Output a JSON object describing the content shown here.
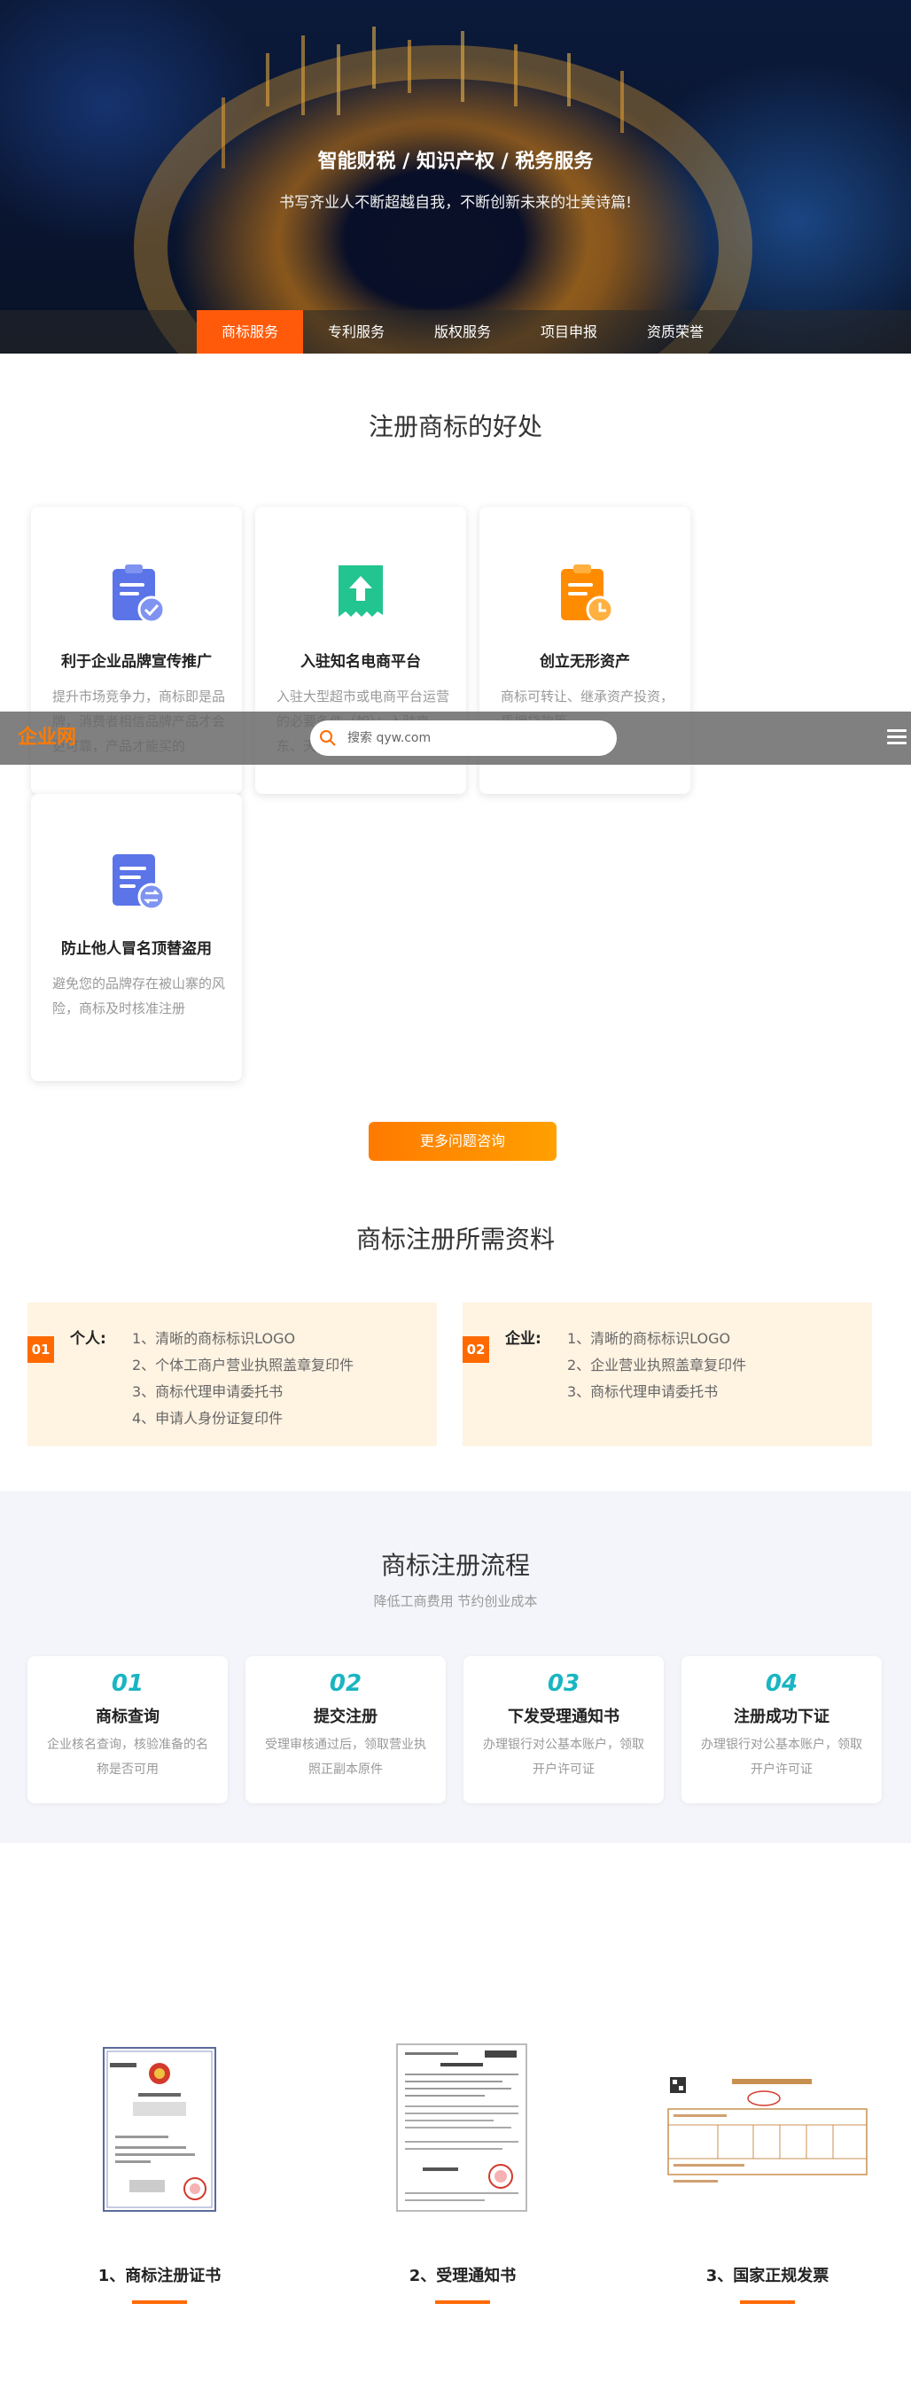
{
  "hero": {
    "title": "智能财税 / 知识产权 / 税务服务",
    "subtitle": "书写齐业人不断超越自我，不断创新未来的壮美诗篇!"
  },
  "service_tabs": [
    {
      "label": "商标服务",
      "active": true
    },
    {
      "label": "专利服务",
      "active": false
    },
    {
      "label": "版权服务",
      "active": false
    },
    {
      "label": "项目申报",
      "active": false
    },
    {
      "label": "资质荣誉",
      "active": false
    }
  ],
  "benefits": {
    "title": "注册商标的好处",
    "cards": [
      {
        "title": "利于企业品牌宣传推广",
        "desc": "提升市场竞争力，商标即是品牌，消费者相信品牌产品才会更可靠，产品才能买的",
        "icon": "clipboard-check-icon"
      },
      {
        "title": "入驻知名电商平台",
        "desc": "入驻大型超市或电商平台运营的必要条件（如）：入驻京东、天猫等",
        "icon": "upload-document-icon"
      },
      {
        "title": "创立无形资产",
        "desc": "商标可转让、继承资产投资，质押贷款等",
        "icon": "clipboard-clock-icon"
      },
      {
        "title": "防止他人冒名顶替盗用",
        "desc": "避免您的品牌存在被山寨的风险，商标及时核准注册",
        "icon": "document-exchange-icon"
      }
    ]
  },
  "search": {
    "logo_text": "企业网",
    "placeholder": "搜索 qyw.com"
  },
  "more_button": "更多问题咨询",
  "materials": {
    "title": "商标注册所需资料",
    "personal": {
      "badge": "01",
      "label": "个人:",
      "items": [
        "1、清晰的商标标识LOGO",
        "2、个体工商户营业执照盖章复印件",
        "3、商标代理申请委托书",
        "4、申请人身份证复印件"
      ]
    },
    "company": {
      "badge": "02",
      "label": "企业:",
      "items": [
        "1、清晰的商标标识LOGO",
        "2、企业营业执照盖章复印件",
        "3、商标代理申请委托书"
      ]
    }
  },
  "process": {
    "title": "商标注册流程",
    "subtitle": "降低工商费用 节约创业成本",
    "steps": [
      {
        "num": "01",
        "title": "商标查询",
        "desc": "企业核名查询，核验准备的名称是否可用"
      },
      {
        "num": "02",
        "title": "提交注册",
        "desc": "受理审核通过后，领取营业执照正副本原件"
      },
      {
        "num": "03",
        "title": "下发受理通知书",
        "desc": "办理银行对公基本账户，领取开户许可证"
      },
      {
        "num": "04",
        "title": "注册成功下证",
        "desc": "办理银行对公基本账户，领取开户许可证"
      }
    ]
  },
  "documents": [
    {
      "title": "1、商标注册证书"
    },
    {
      "title": "2、受理通知书"
    },
    {
      "title": "3、国家正规发票"
    }
  ],
  "colors": {
    "accent": "#ff6a00",
    "teal": "#19b5c2",
    "cream": "#fff3e2"
  }
}
